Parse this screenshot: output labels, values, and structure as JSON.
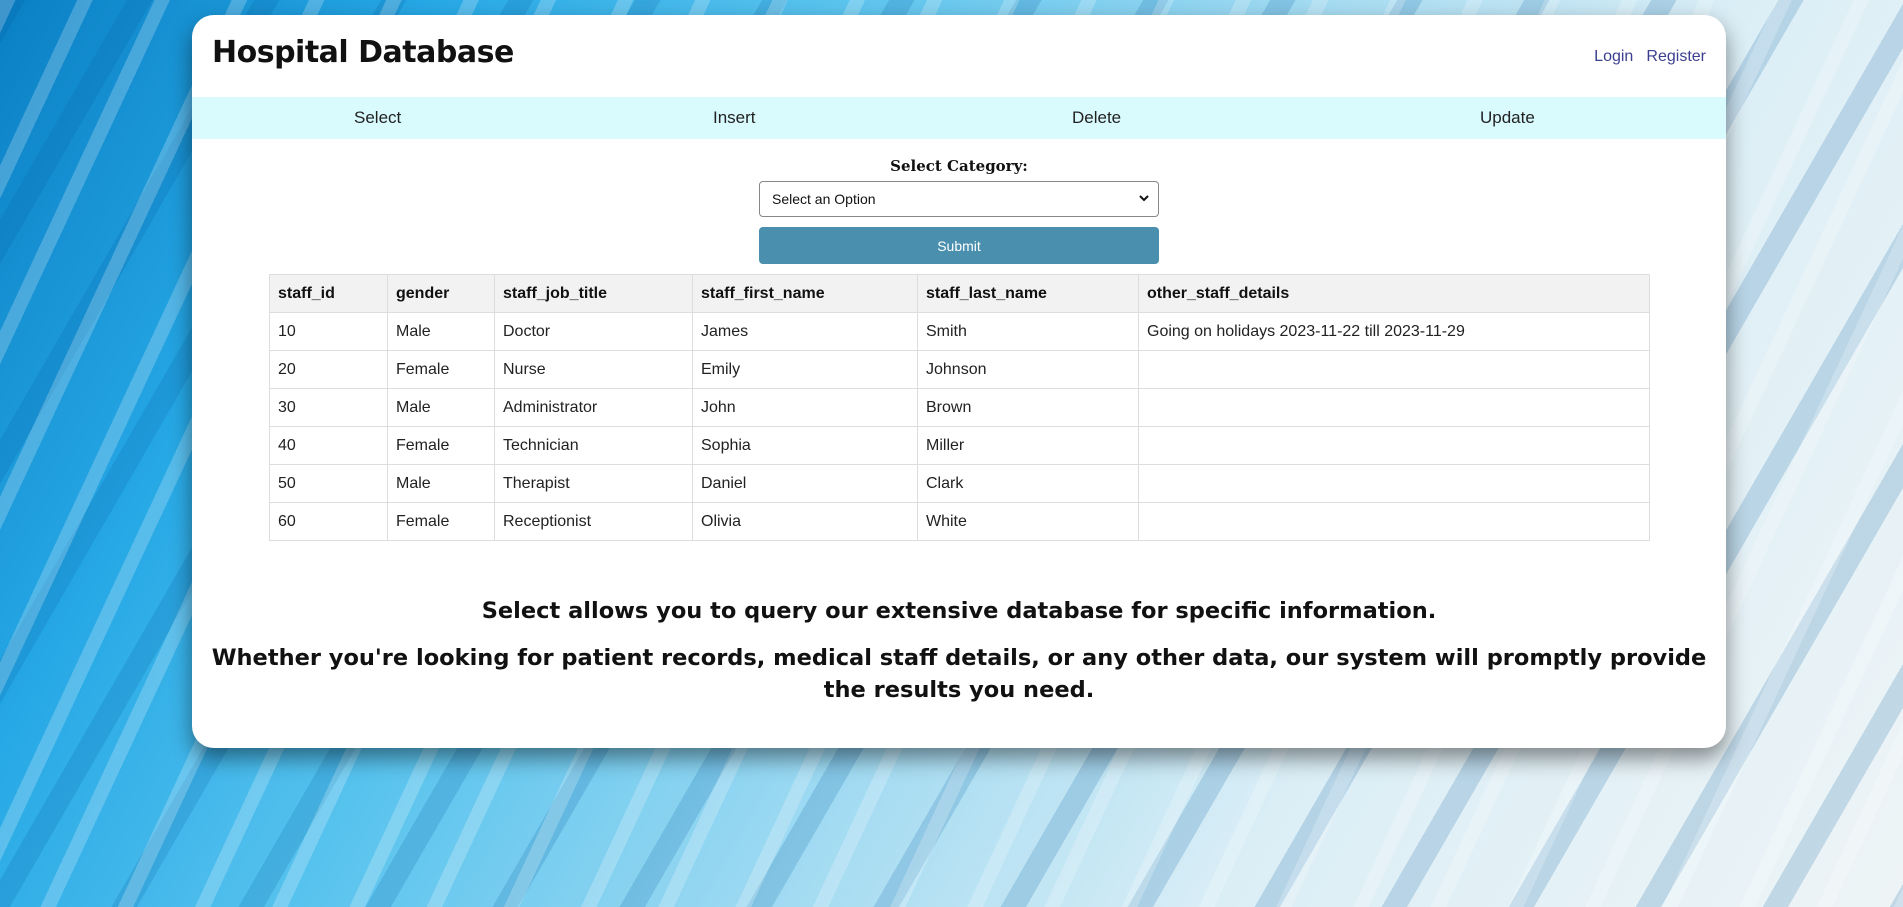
{
  "header": {
    "title": "Hospital Database",
    "login_label": "Login",
    "register_label": "Register"
  },
  "nav": {
    "items": [
      {
        "label": "Select"
      },
      {
        "label": "Insert"
      },
      {
        "label": "Delete"
      },
      {
        "label": "Update"
      }
    ]
  },
  "form": {
    "category_label": "Select Category:",
    "select_value": "Select an Option",
    "submit_label": "Submit"
  },
  "table": {
    "columns": [
      "staff_id",
      "gender",
      "staff_job_title",
      "staff_first_name",
      "staff_last_name",
      "other_staff_details"
    ],
    "rows": [
      [
        "10",
        "Male",
        "Doctor",
        "James",
        "Smith",
        "Going on holidays 2023-11-22 till 2023-11-29"
      ],
      [
        "20",
        "Female",
        "Nurse",
        "Emily",
        "Johnson",
        ""
      ],
      [
        "30",
        "Male",
        "Administrator",
        "John",
        "Brown",
        ""
      ],
      [
        "40",
        "Female",
        "Technician",
        "Sophia",
        "Miller",
        ""
      ],
      [
        "50",
        "Male",
        "Therapist",
        "Daniel",
        "Clark",
        ""
      ],
      [
        "60",
        "Female",
        "Receptionist",
        "Olivia",
        "White",
        ""
      ]
    ]
  },
  "info": {
    "line1": "Select allows you to query our extensive database for specific information.",
    "line2": "Whether you're looking for patient records, medical staff details, or any other data, our system will promptly provide the results you need."
  },
  "colors": {
    "nav_background": "#d9fbfd",
    "submit_button": "#4b8fae",
    "auth_links": "#3b3f8f"
  }
}
